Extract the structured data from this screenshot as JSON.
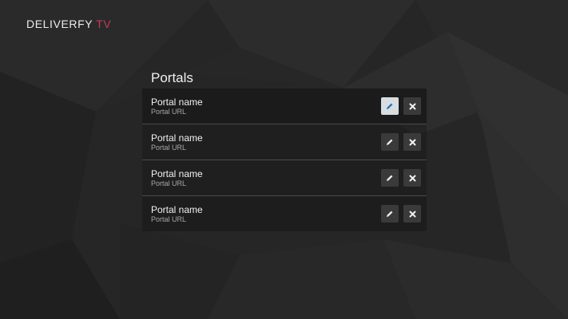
{
  "header": {
    "brand": "DELIVERFY",
    "brand_suffix": "TV"
  },
  "portals": {
    "title": "Portals",
    "items": [
      {
        "name": "Portal name",
        "url": "Portal URL"
      },
      {
        "name": "Portal name",
        "url": "Portal URL"
      },
      {
        "name": "Portal name",
        "url": "Portal URL"
      },
      {
        "name": "Portal name",
        "url": "Portal URL"
      }
    ],
    "edit_icon": "pencil-icon",
    "delete_icon": "close-icon"
  },
  "colors": {
    "accent": "#c23a5b",
    "background": "#252525",
    "focus_button": "#d7dde1",
    "button": "#3a3a3a"
  }
}
